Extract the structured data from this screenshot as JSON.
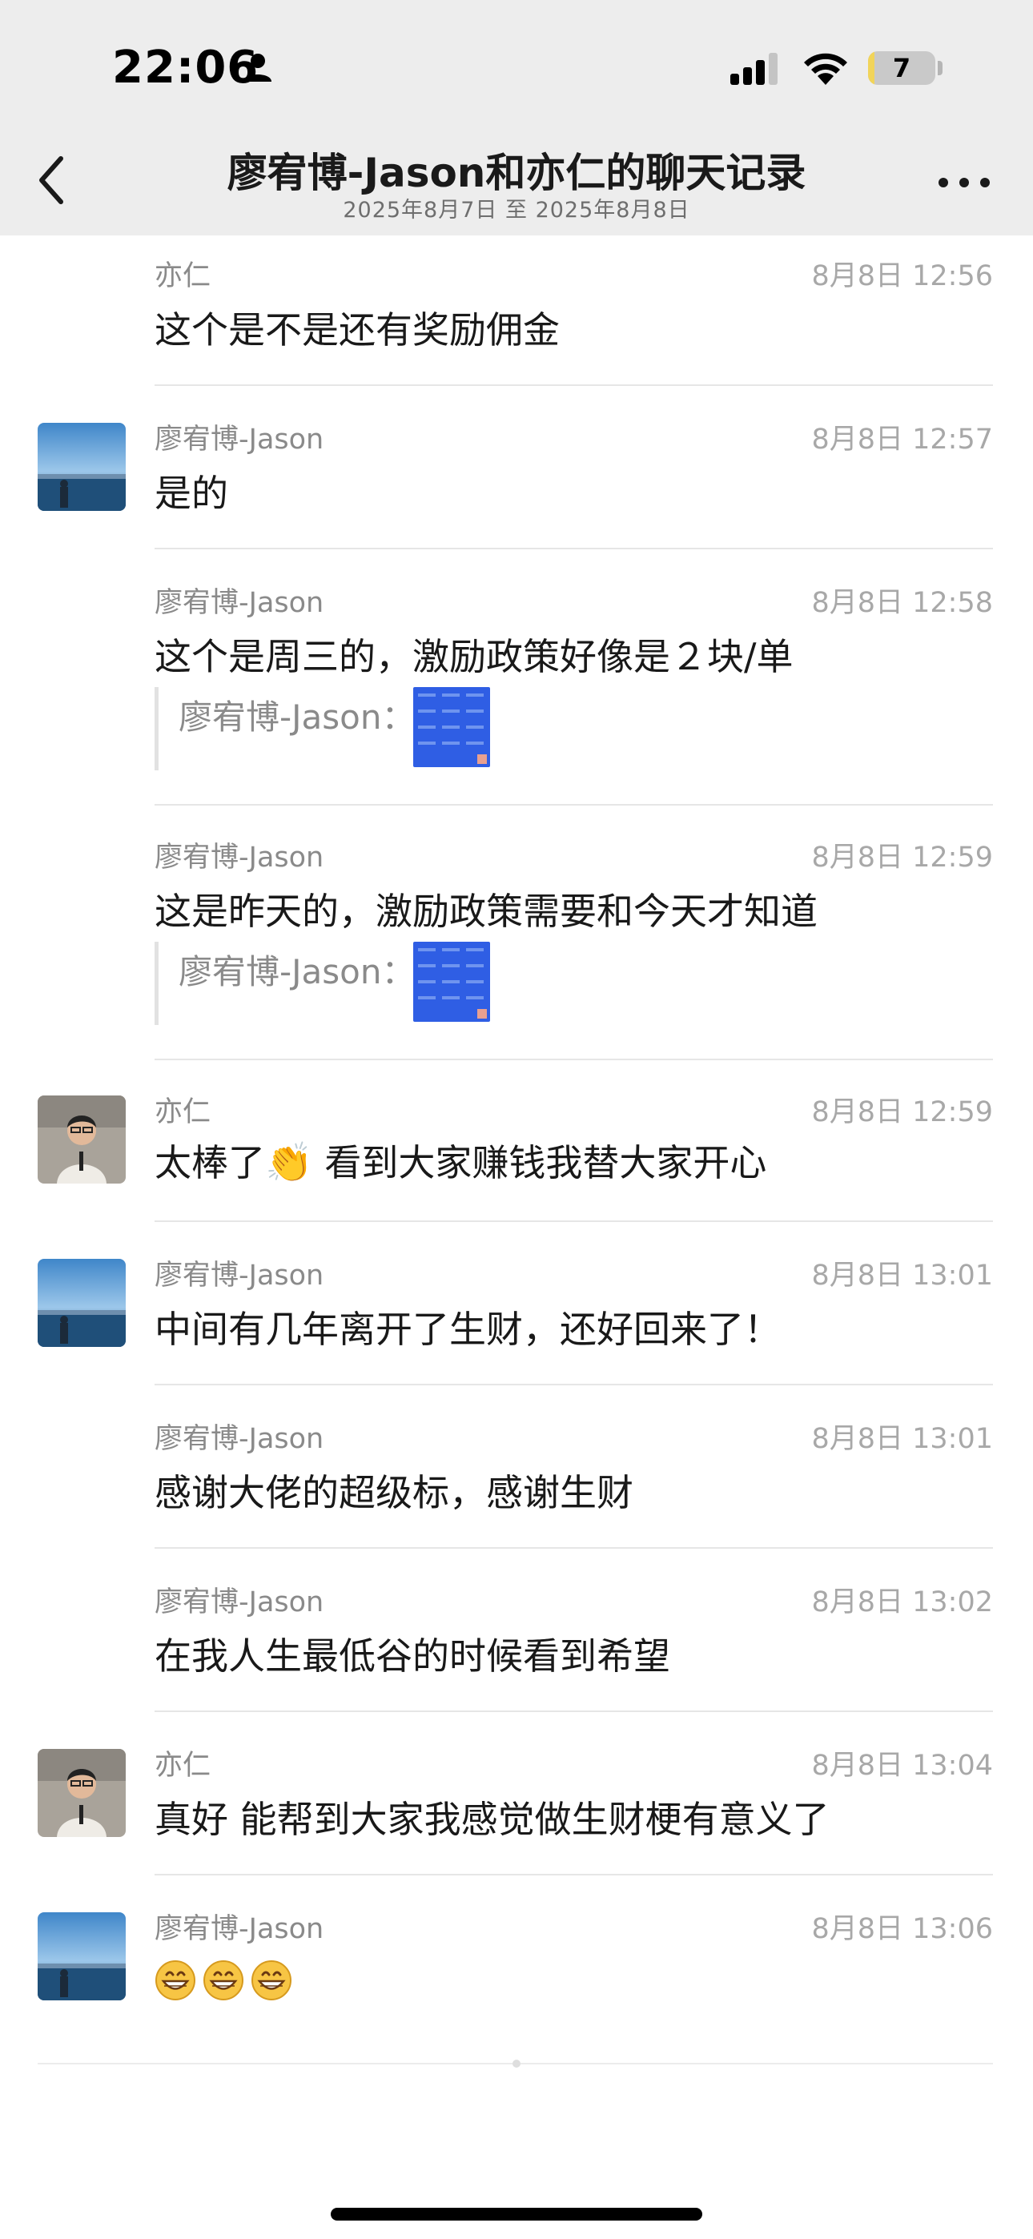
{
  "status_bar": {
    "time": "22:06",
    "battery": "7",
    "icons": [
      "person-icon",
      "signal-icon",
      "wifi-icon",
      "battery-icon"
    ]
  },
  "nav": {
    "title": "廖宥博-Jason和亦仁的聊天记录",
    "subtitle": "2025年8月7日 至 2025年8月8日",
    "back_icon": "chevron-left-icon",
    "more_icon": "more-dots-icon"
  },
  "messages": [
    {
      "sender": "亦仁",
      "time": "8月8日 12:56",
      "text": "这个是不是还有奖励佣金"
    },
    {
      "sender": "廖宥博-Jason",
      "time": "8月8日 12:57",
      "text": "是的"
    },
    {
      "sender": "廖宥博-Jason",
      "time": "8月8日 12:58",
      "text": "这个是周三的，激励政策好像是２块/单",
      "quote": "廖宥博-Jason："
    },
    {
      "sender": "廖宥博-Jason",
      "time": "8月8日 12:59",
      "text": "这是昨天的，激励政策需要和今天才知道",
      "quote": "廖宥博-Jason："
    },
    {
      "sender": "亦仁",
      "time": "8月8日 12:59",
      "text_before": "太棒了",
      "emoji": "👏",
      "text_after": " 看到大家赚钱我替大家开心"
    },
    {
      "sender": "廖宥博-Jason",
      "time": "8月8日 13:01",
      "text": "中间有几年离开了生财，还好回来了！"
    },
    {
      "sender": "廖宥博-Jason",
      "time": "8月8日 13:01",
      "text": "感谢大佬的超级标，感谢生财"
    },
    {
      "sender": "廖宥博-Jason",
      "time": "8月8日 13:02",
      "text": "在我人生最低谷的时候看到希望"
    },
    {
      "sender": "亦仁",
      "time": "8月8日 13:04",
      "text": "真好 能帮到大家我感觉做生财梗有意义了"
    },
    {
      "sender": "廖宥博-Jason",
      "time": "8月8日 13:06",
      "emoji_count": 3
    }
  ],
  "colors": {
    "nav_bg": "#ededed",
    "text": "#191919",
    "meta_text": "#8a8a8a",
    "divider": "#e6e6e6",
    "quote_thumb": "#2f5ee4"
  }
}
